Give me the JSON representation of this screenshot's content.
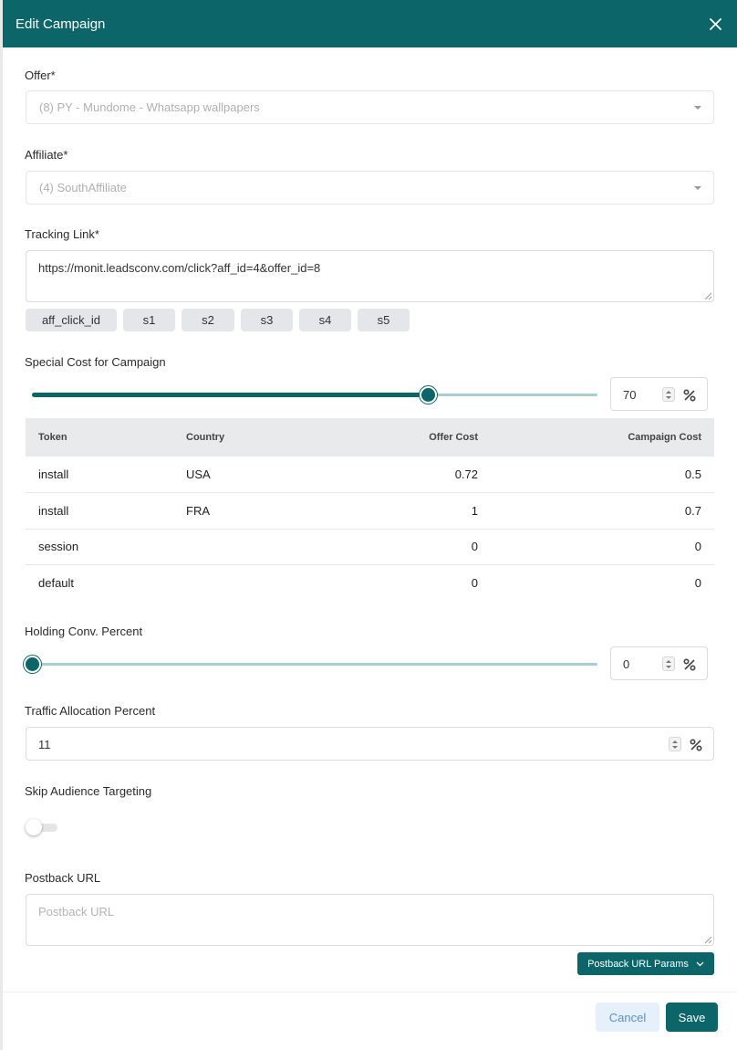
{
  "modal": {
    "title": "Edit Campaign",
    "close_icon": "close-icon"
  },
  "offer": {
    "label": "Offer*",
    "value": "(8) PY - Mundome - Whatsapp wallpapers"
  },
  "affiliate": {
    "label": "Affiliate*",
    "value": "(4) SouthAffiliate"
  },
  "tracking_link": {
    "label": "Tracking Link*",
    "value": "https://monit.leadsconv.com/click?aff_id=4&offer_id=8",
    "tokens": [
      "aff_click_id",
      "s1",
      "s2",
      "s3",
      "s4",
      "s5"
    ]
  },
  "special_cost": {
    "label": "Special Cost for Campaign",
    "slider_value": 70,
    "input_value": "70",
    "unit_icon": "percent-icon"
  },
  "cost_table": {
    "headers": [
      "Token",
      "Country",
      "Offer Cost",
      "Campaign Cost"
    ],
    "rows": [
      [
        "install",
        "USA",
        "0.72",
        "0.5"
      ],
      [
        "install",
        "FRA",
        "1",
        "0.7"
      ],
      [
        "session",
        "",
        "0",
        "0"
      ],
      [
        "default",
        "",
        "0",
        "0"
      ]
    ]
  },
  "holding_conv": {
    "label": "Holding Conv. Percent",
    "slider_value": 0,
    "input_value": "0"
  },
  "traffic_allocation": {
    "label": "Traffic Allocation Percent",
    "input_value": "11"
  },
  "skip_audience": {
    "label": "Skip Audience Targeting",
    "enabled": false
  },
  "postback": {
    "label": "Postback URL",
    "placeholder": "Postback URL",
    "params_button": "Postback URL Params"
  },
  "footer": {
    "cancel": "Cancel",
    "save": "Save"
  },
  "colors": {
    "primary": "#0c6669",
    "slider_track": "#a7cfd0",
    "cancel_bg": "#e6f0fa",
    "cancel_text": "#5a93c9"
  }
}
